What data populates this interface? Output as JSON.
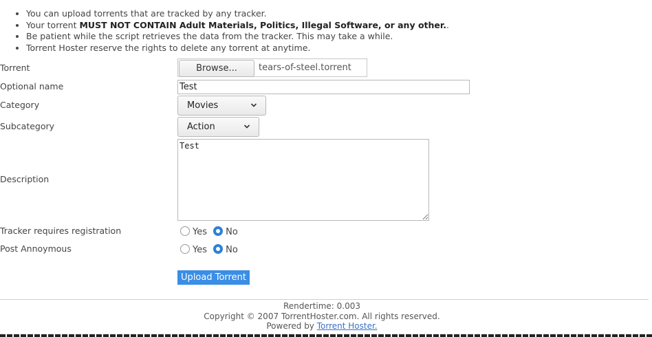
{
  "rules": [
    {
      "pre": "You can upload torrents that are tracked by any tracker.",
      "bold": "",
      "post": ""
    },
    {
      "pre": "Your torrent ",
      "bold": "MUST NOT CONTAIN Adult Materials, Politics, Illegal Software, or any other.",
      "post": "."
    },
    {
      "pre": "Be patient while the script retrieves the data from the tracker. This may take a while.",
      "bold": "",
      "post": ""
    },
    {
      "pre": "Torrent Hoster reserve the rights to delete any torrent at anytime.",
      "bold": "",
      "post": ""
    }
  ],
  "form": {
    "torrent_label": "Torrent",
    "browse_label": "Browse...",
    "file_name": "tears-of-steel.torrent",
    "optional_name_label": "Optional name",
    "optional_name_value": "Test",
    "category_label": "Category",
    "category_value": "Movies",
    "subcategory_label": "Subcategory",
    "subcategory_value": "Action",
    "description_label": "Description",
    "description_value": "Test",
    "tracker_label": "Tracker requires registration",
    "anon_label": "Post Annoymous",
    "yes_label": "Yes",
    "no_label": "No",
    "tracker_selected": "No",
    "anon_selected": "No",
    "upload_label": "Upload Torrent"
  },
  "footer": {
    "rendertime": "Rendertime: 0.003",
    "copyright": "Copyright © 2007 TorrentHoster.com. All rights reserved.",
    "powered_prefix": "Powered by ",
    "powered_link": "Torrent Hoster."
  },
  "colors": {
    "accent": "#3a8ee6",
    "radio_checked": "#2d80d8",
    "link": "#3a6fc4"
  }
}
